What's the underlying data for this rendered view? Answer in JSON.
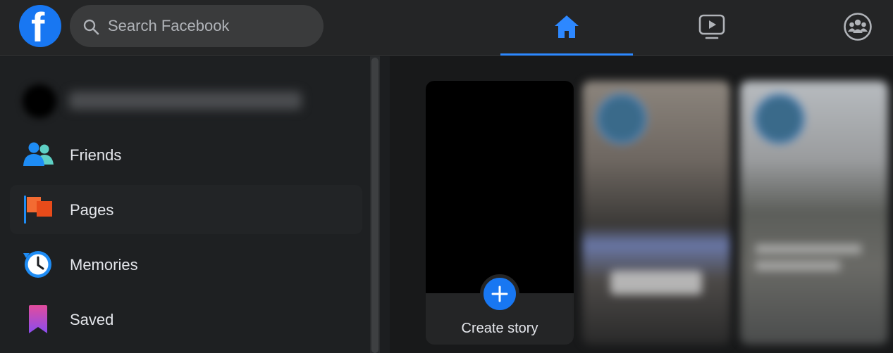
{
  "header": {
    "logo_letter": "f",
    "search_placeholder": "Search Facebook",
    "nav": [
      {
        "icon": "home-icon",
        "active": true
      },
      {
        "icon": "watch-icon",
        "active": false
      },
      {
        "icon": "groups-icon",
        "active": false
      }
    ]
  },
  "sidebar": {
    "items": [
      {
        "label": "Friends",
        "icon": "friends-icon"
      },
      {
        "label": "Pages",
        "icon": "pages-flag-icon"
      },
      {
        "label": "Memories",
        "icon": "memories-clock-icon"
      },
      {
        "label": "Saved",
        "icon": "saved-bookmark-icon"
      }
    ]
  },
  "stories": {
    "create_label": "Create story"
  },
  "colors": {
    "brand_blue": "#1877f2",
    "active_tab": "#2d88ff",
    "background": "#18191a",
    "surface": "#242526"
  }
}
